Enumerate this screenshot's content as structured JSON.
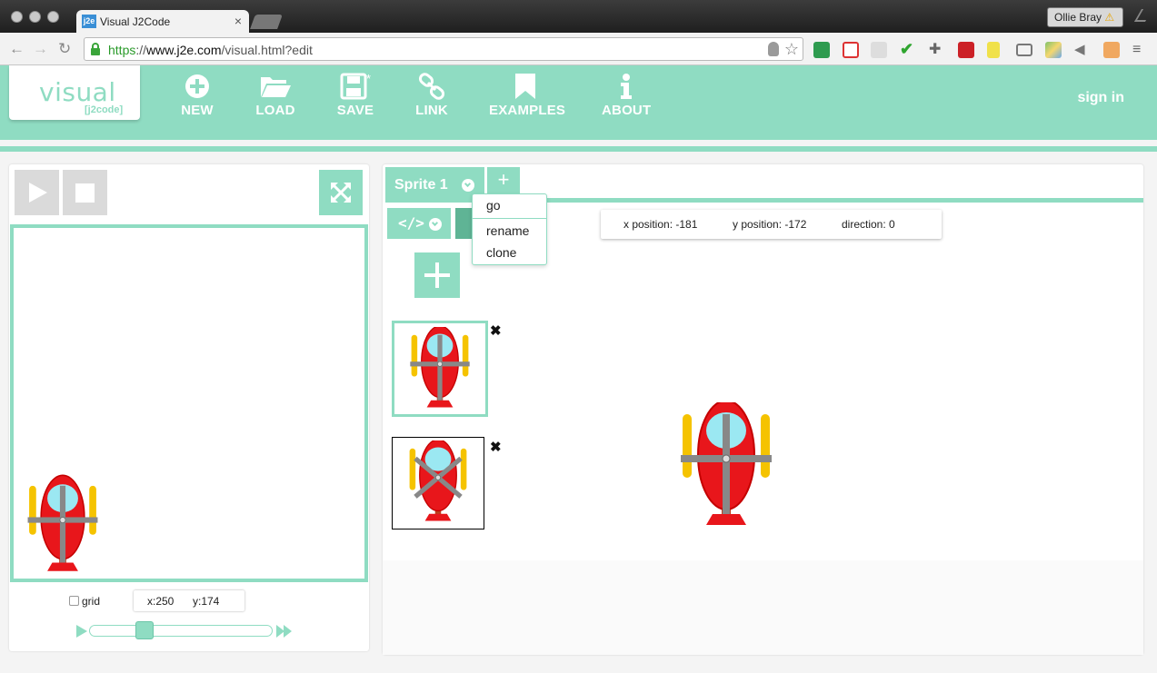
{
  "browser": {
    "tab_title": "Visual J2Code",
    "tab_favicon": "j2e",
    "url_scheme": "https",
    "url_separator": "://",
    "url_host": "www.j2e.com",
    "url_path": "/visual.html?edit",
    "user_name": "Ollie Bray",
    "warning_icon": "⚠"
  },
  "header": {
    "logo_main": "visual",
    "logo_sub": "[j2code]",
    "menu": [
      {
        "label": "NEW",
        "icon": "plus-circle-icon"
      },
      {
        "label": "LOAD",
        "icon": "folder-icon"
      },
      {
        "label": "SAVE",
        "icon": "save-icon"
      },
      {
        "label": "LINK",
        "icon": "link-icon"
      },
      {
        "label": "EXAMPLES",
        "icon": "bookmark-icon"
      },
      {
        "label": "ABOUT",
        "icon": "info-icon"
      }
    ],
    "signin": "sign in"
  },
  "stage": {
    "grid_label": "grid",
    "grid_checked": false,
    "x_readout": "x:250",
    "y_readout": "y:174"
  },
  "editor": {
    "sprite_tab": "Sprite 1",
    "add_tab": "+",
    "dropdown": [
      "go",
      "rename",
      "clone"
    ],
    "info": {
      "x": "x position: -181",
      "y": "y position: -172",
      "direction": "direction: 0"
    },
    "delete_symbol": "✖",
    "code_glyph": "</>"
  },
  "colors": {
    "accent": "#8fdcc2",
    "heli_red": "#e8161b",
    "heli_yellow": "#f5c300",
    "heli_gray": "#888888",
    "heli_glass": "#9be8f2",
    "heli_tail": "#b9401d"
  }
}
